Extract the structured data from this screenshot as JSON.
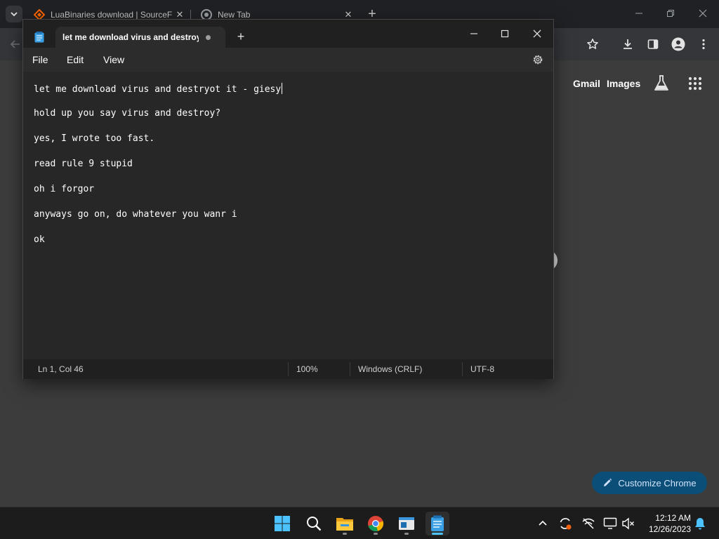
{
  "chrome": {
    "tabs": [
      {
        "title": "LuaBinaries download | SourceF",
        "close": "✕"
      },
      {
        "title": "New Tab",
        "close": "✕"
      }
    ],
    "new_tab": "+",
    "ntp_links": {
      "gmail": "Gmail",
      "images": "Images"
    },
    "customize_label": "Customize Chrome"
  },
  "notepad": {
    "tab_title": "let me download virus and destroyt it - giesy",
    "new_tab": "+",
    "menus": [
      "File",
      "Edit",
      "View"
    ],
    "lines": [
      "let me download virus and destryot it - giesy",
      "hold up you say virus and destroy?",
      "yes, I wrote too fast.",
      "read rule 9 stupid",
      "oh i forgor",
      "anyways go on, do whatever you wanr i",
      "ok"
    ],
    "status": {
      "position": "Ln 1, Col 46",
      "zoom": "100%",
      "line_ending": "Windows (CRLF)",
      "encoding": "UTF-8"
    }
  },
  "taskbar": {
    "apps": [
      "windows-start-icon",
      "search-icon",
      "file-explorer-icon",
      "chrome-icon",
      "app-window-icon",
      "notepad-icon"
    ],
    "time": "12:12 AM",
    "date": "12/26/2023"
  }
}
